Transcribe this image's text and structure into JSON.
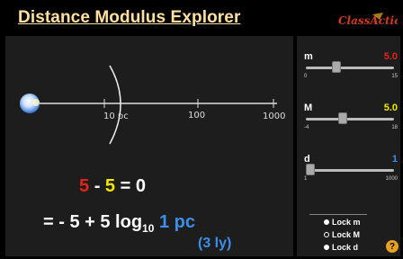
{
  "app": {
    "title": "Distance Modulus Explorer",
    "logo": "ClassAction"
  },
  "viz": {
    "tick_labels": [
      "10 pc",
      "100",
      "1000"
    ],
    "eq_line1": {
      "m": "5",
      "minus": "-",
      "M": "5",
      "equals": "= 0"
    },
    "eq_line2": {
      "prefix": "= - 5 + 5 log",
      "subscript": "10",
      "d_value": "1 pc",
      "ly": "(3 ly)"
    }
  },
  "controls": {
    "sliders": [
      {
        "name": "m",
        "value": "5.0",
        "min": "0",
        "max": "15",
        "level_fraction": 0.33,
        "value_color": "#e2231a"
      },
      {
        "name": "M",
        "value": "5.0",
        "min": "-4",
        "max": "18",
        "level_fraction": 0.41,
        "value_color": "#f2e600"
      },
      {
        "name": "d",
        "value": "1",
        "min": "1",
        "max": "1000",
        "level_fraction": 0.0,
        "value_color": "#3d8ee8"
      }
    ],
    "locks": [
      {
        "label": "Lock  m",
        "selected": true
      },
      {
        "label": "Lock M",
        "selected": false
      },
      {
        "label": "Lock d",
        "selected": true
      }
    ],
    "help_label": "?"
  }
}
